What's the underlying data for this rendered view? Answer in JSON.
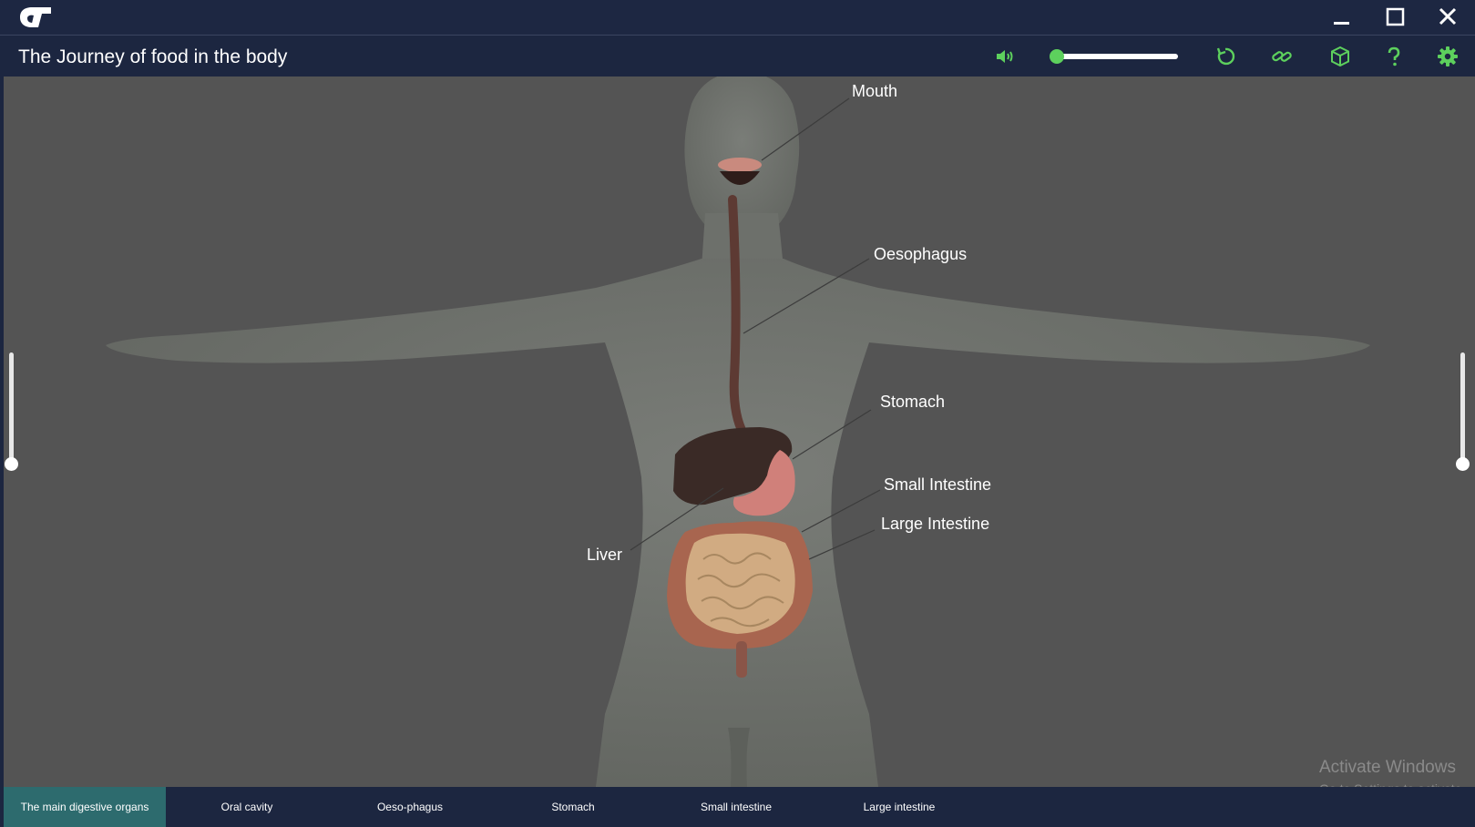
{
  "window": {
    "logo_icon": "app-logo-icon",
    "controls": [
      "minimize-icon",
      "maximize-icon",
      "close-icon"
    ]
  },
  "header": {
    "title": "The Journey of food in the body",
    "accent_color": "#5dd05d",
    "volume_level": 0.0,
    "icons": [
      "speaker-icon",
      "reset-icon",
      "link-icon",
      "3d-cube-icon",
      "help-icon",
      "gear-icon"
    ]
  },
  "scene": {
    "labels": {
      "mouth": "Mouth",
      "oesophagus": "Oesophagus",
      "stomach": "Stomach",
      "small_intestine": "Small Intestine",
      "large_intestine": "Large Intestine",
      "liver": "Liver"
    },
    "left_slider_level": 0.0,
    "right_slider_level": 0.0
  },
  "tabs": [
    {
      "label": "The main digestive organs",
      "active": true
    },
    {
      "label": "Oral cavity",
      "active": false
    },
    {
      "label": "Oeso-phagus",
      "active": false
    },
    {
      "label": "Stomach",
      "active": false
    },
    {
      "label": "Small intestine",
      "active": false
    },
    {
      "label": "Large intestine",
      "active": false
    }
  ],
  "watermark": {
    "line1": "Activate Windows",
    "line2": "Go to Settings to activate"
  }
}
